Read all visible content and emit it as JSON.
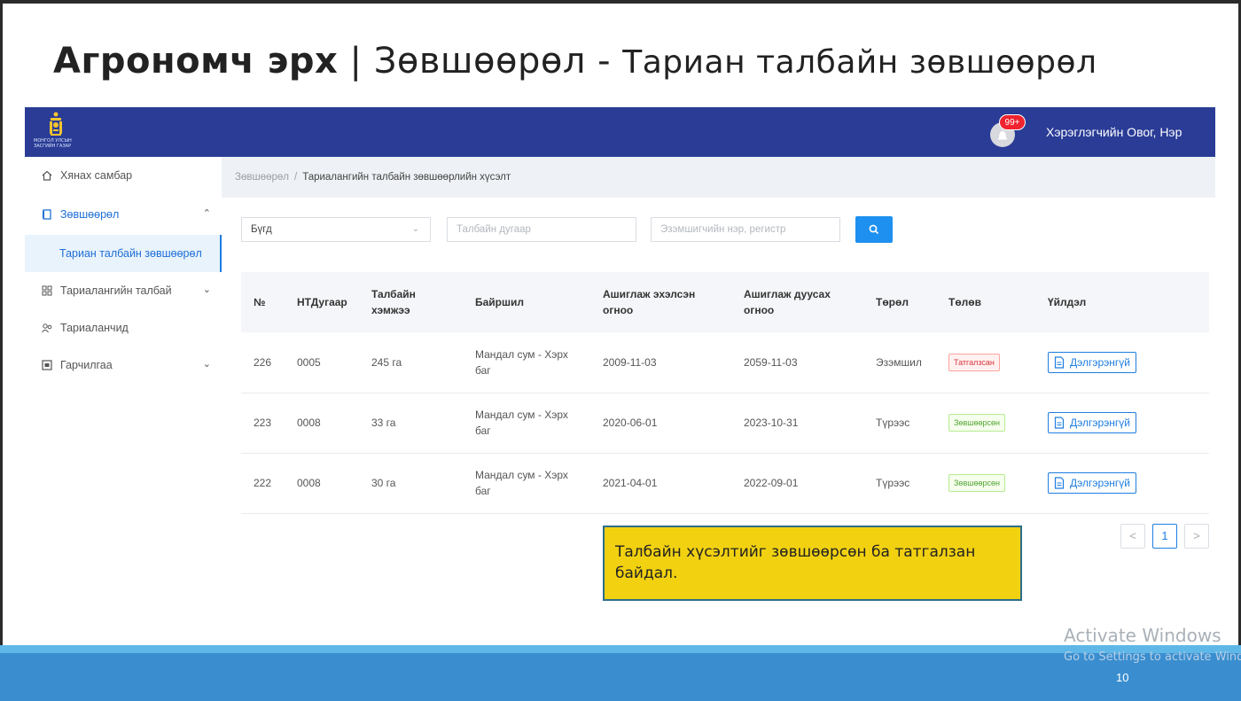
{
  "slide": {
    "title_bold": "Агрономч эрх",
    "title_sep": " | ",
    "title_mid": "Зөвшөөрөл - ",
    "title_small": "Тариан талбайн зөвшөөрөл",
    "callout": "Талбайн хүсэлтийг зөвшөөрсөн ба татгалзан байдал.",
    "page_number": "10",
    "watermark_title": "Activate Windows",
    "watermark_sub": "Go to Settings to activate Windows."
  },
  "header": {
    "logo_text_line1": "МОНГОЛ УЛСЫН",
    "logo_text_line2": "ЗАСГИЙН ГАЗАР",
    "badge": "99+",
    "user_name": "Хэрэглэгчийн Овог, Нэр"
  },
  "sidebar": {
    "items": [
      {
        "label": "Хянах самбар",
        "icon": "home-icon"
      },
      {
        "label": "Зөвшөөрөл",
        "icon": "document-icon"
      },
      {
        "label": "Тариан талбайн зөвшөөрөл"
      },
      {
        "label": "Тариалангийн талбай",
        "icon": "grid-icon"
      },
      {
        "label": "Тариаланчид",
        "icon": "users-icon"
      },
      {
        "label": "Гарчилгаа",
        "icon": "calendar-icon"
      }
    ]
  },
  "breadcrumb": {
    "parent": "Зөвшөөрөл",
    "separator": "/",
    "current": "Тариалангийн талбайн зөвшөөрлийн хүсэлт"
  },
  "filters": {
    "status_value": "Бүгд",
    "field_number_placeholder": "Талбайн дугаар",
    "owner_placeholder": "Эзэмшигчийн нэр, регистр"
  },
  "table": {
    "headers": [
      "№",
      "НТДугаар",
      "Талбайн хэмжээ",
      "Байршил",
      "Ашиглаж эхэлсэн огноо",
      "Ашиглаж дуусах огноо",
      "Төрөл",
      "Төлөв",
      "Үйлдэл"
    ],
    "rows": [
      {
        "no": "226",
        "nt": "0005",
        "size": "245 га",
        "location": "Мандал сум - Хэрх баг",
        "start": "2009-11-03",
        "end": "2059-11-03",
        "type": "Эзэмшил",
        "status": "Татгалзсан",
        "status_color": "#d9363e",
        "action": "Дэлгэрэнгүй"
      },
      {
        "no": "223",
        "nt": "0008",
        "size": "33 га",
        "location": "Мандал сум - Хэрх баг",
        "start": "2020-06-01",
        "end": "2023-10-31",
        "type": "Түрээс",
        "status": "Зөвшөөрсөн",
        "status_color": "#52a335",
        "action": "Дэлгэрэнгүй"
      },
      {
        "no": "222",
        "nt": "0008",
        "size": "30 га",
        "location": "Мандал сум - Хэрх баг",
        "start": "2021-04-01",
        "end": "2022-09-01",
        "type": "Түрээс",
        "status": "Зөвшөөрсөн",
        "status_color": "#52a335",
        "action": "Дэлгэрэнгүй"
      }
    ]
  },
  "pagination": {
    "prev": "<",
    "current": "1",
    "next": ">"
  },
  "colors": {
    "topbar": "#2a3c96",
    "primary": "#1e90f0",
    "callout": "#f2d111",
    "band": "#3a8ecf"
  }
}
